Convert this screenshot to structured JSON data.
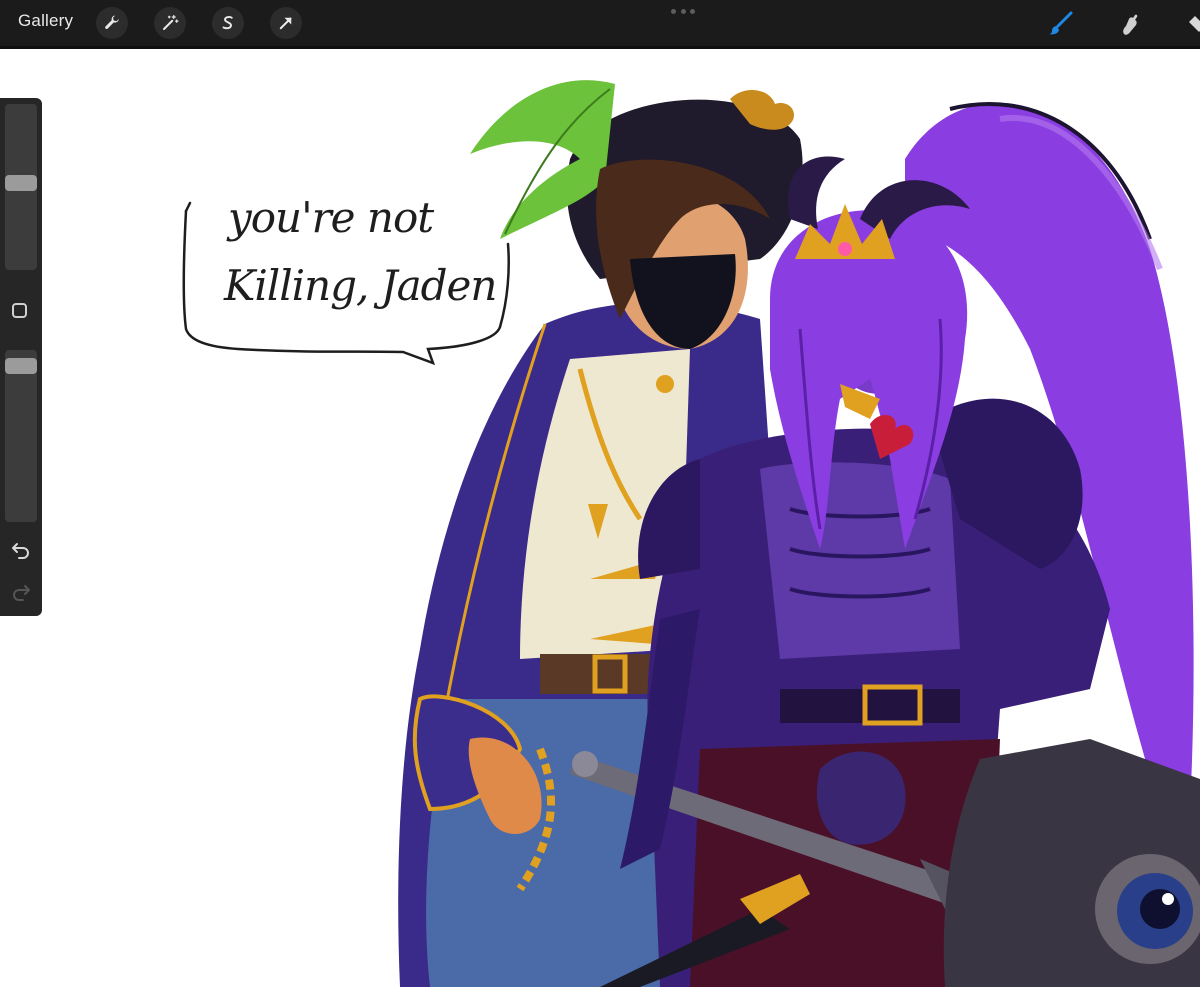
{
  "app": {
    "gallery_label": "Gallery",
    "toolbar_left": [
      "wrench-icon",
      "magic-wand-icon",
      "selection-s-icon",
      "transform-arrow-icon"
    ],
    "toolbar_right": [
      "brush-icon",
      "smudge-icon",
      "eraser-icon"
    ],
    "accent_color": "#1e88e5"
  },
  "sidebar": {
    "brush_size_level": 0.53,
    "opacity_level": 0.05,
    "modify_button": "modify-square-icon",
    "undo": "undo-icon",
    "redo": "redo-icon"
  },
  "artwork": {
    "speech_line_1": "you're not",
    "speech_line_2": "Killing, Jaden",
    "palette": {
      "purple_armor": "#4b2a9a",
      "violet_hair": "#8a3de0",
      "navy_coat": "#3a2a8a",
      "gold": "#e0a020",
      "shirt": "#efe8d0",
      "feather": "#6cc23a"
    }
  }
}
